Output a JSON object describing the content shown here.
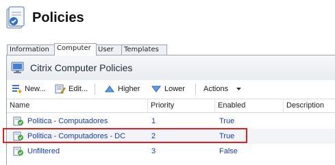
{
  "header": {
    "title": "Policies",
    "icon": "policies-icon"
  },
  "tabs": [
    {
      "label": "Information",
      "active": false
    },
    {
      "label": "Computer",
      "active": true
    },
    {
      "label": "User",
      "active": false
    },
    {
      "label": "Templates",
      "active": false
    }
  ],
  "section": {
    "title": "Citrix Computer Policies",
    "icon": "citrix-computer-icon"
  },
  "toolbar": {
    "new_label": "New...",
    "edit_label": "Edit...",
    "higher_label": "Higher",
    "lower_label": "Lower",
    "actions_label": "Actions"
  },
  "table": {
    "columns": [
      "Name",
      "Priority",
      "Enabled",
      "Description"
    ],
    "rows": [
      {
        "name": "Politica - Computadores",
        "priority": "1",
        "enabled": "True",
        "description": ""
      },
      {
        "name": "Politica - Computadores - DC",
        "priority": "2",
        "enabled": "True",
        "description": ""
      },
      {
        "name": "Unfiltered",
        "priority": "3",
        "enabled": "False",
        "description": ""
      }
    ]
  },
  "colors": {
    "accent": "#1a3fa8",
    "highlight_border": "#e02020",
    "tab_border": "#9aa3ad"
  }
}
